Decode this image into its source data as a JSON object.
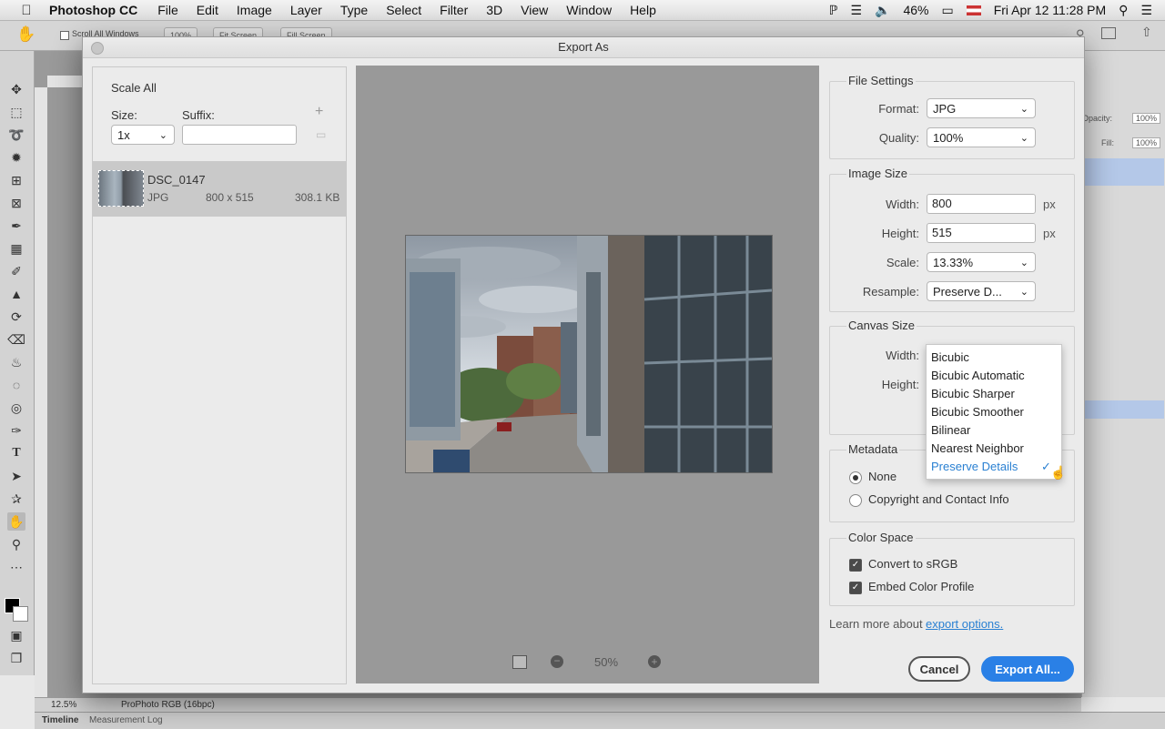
{
  "menubar": {
    "app": "Photoshop CC",
    "items": [
      "File",
      "Edit",
      "Image",
      "Layer",
      "Type",
      "Select",
      "Filter",
      "3D",
      "View",
      "Window",
      "Help"
    ],
    "battery": "46%",
    "datetime": "Fri Apr 12  11:28 PM"
  },
  "optionsbar": {
    "scroll_all": "Scroll All Windows",
    "btn1": "100%",
    "btn2": "Fit Screen",
    "btn3": "Fill Screen"
  },
  "dialog": {
    "title": "Export As",
    "scale_all": {
      "heading": "Scale All",
      "size_label": "Size:",
      "suffix_label": "Suffix:",
      "size_value": "1x",
      "suffix_value": ""
    },
    "file": {
      "name": "DSC_0147",
      "format": "JPG",
      "dimensions": "800 x 515",
      "filesize": "308.1 KB"
    },
    "zoom": "50%",
    "file_settings": {
      "heading": "File Settings",
      "format_label": "Format:",
      "format_value": "JPG",
      "quality_label": "Quality:",
      "quality_value": "100%"
    },
    "image_size": {
      "heading": "Image Size",
      "width_label": "Width:",
      "width_value": "800",
      "height_label": "Height:",
      "height_value": "515",
      "unit": "px",
      "scale_label": "Scale:",
      "scale_value": "13.33%",
      "resample_label": "Resample:",
      "resample_value": "Preserve D..."
    },
    "canvas_size": {
      "heading": "Canvas Size",
      "width_label": "Width:",
      "height_label": "Height:"
    },
    "resample_options": [
      "Bicubic",
      "Bicubic Automatic",
      "Bicubic Sharper",
      "Bicubic Smoother",
      "Bilinear",
      "Nearest Neighbor",
      "Preserve Details"
    ],
    "resample_selected": "Preserve Details",
    "metadata": {
      "heading": "Metadata",
      "none": "None",
      "copyright": "Copyright and Contact Info"
    },
    "color_space": {
      "heading": "Color Space",
      "convert": "Convert to sRGB",
      "embed": "Embed Color Profile"
    },
    "learn_more": "Learn more about",
    "learn_link": "export options.",
    "cancel": "Cancel",
    "export": "Export All..."
  },
  "status": {
    "zoom": "12.5%",
    "profile": "ProPhoto RGB (16bpc)"
  },
  "timeline": {
    "tab1": "Timeline",
    "tab2": "Measurement Log"
  },
  "rpanel": {
    "opacity_label": "Opacity:",
    "opacity": "100%",
    "fill_label": "Fill:",
    "fill": "100%"
  }
}
